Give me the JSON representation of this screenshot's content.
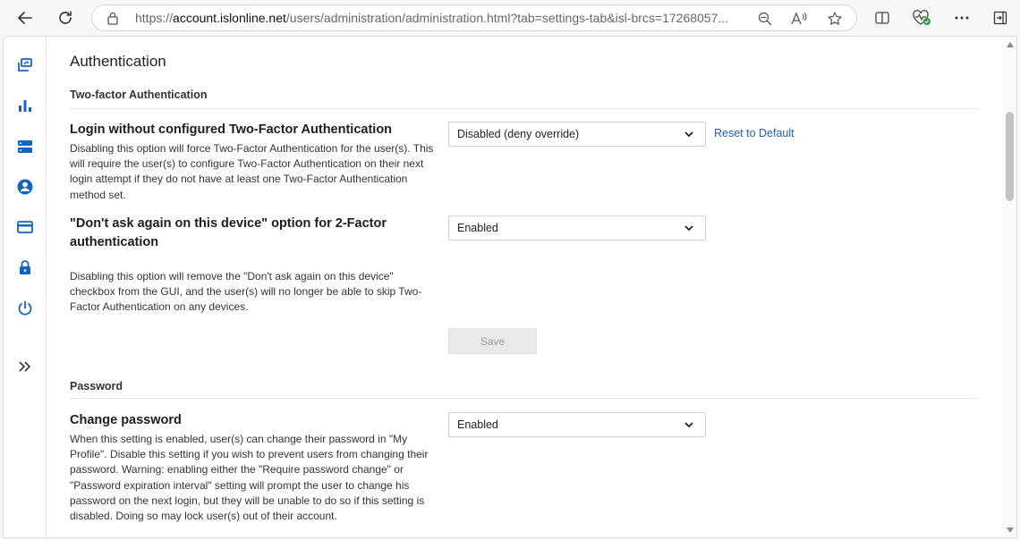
{
  "browser": {
    "url_prefix": "https://",
    "url_host": "account.islonline.net",
    "url_path": "/users/administration/administration.html?tab=settings-tab&isl-brcs=17268057..."
  },
  "sidebar": {
    "items": [
      "sessions-icon",
      "stats-icon",
      "servers-icon",
      "user-icon",
      "card-icon",
      "lock-icon",
      "power-icon"
    ],
    "expand_icon": "chevron-double-right-icon"
  },
  "page": {
    "title": "Authentication"
  },
  "two_factor": {
    "section_title": "Two-factor Authentication",
    "settings": [
      {
        "title": "Login without configured Two-Factor Authentication",
        "description": "Disabling this option will force Two-Factor Authentication for the user(s). This will require the user(s) to configure Two-Factor Authentication on their next login attempt if they do not have at least one Two-Factor Authentication method set.",
        "value": "Disabled (deny override)",
        "reset_label": "Reset to Default"
      },
      {
        "title": "\"Don't ask again on this device\" option for 2-Factor authentication",
        "description": "Disabling this option will remove the \"Don't ask again on this device\" checkbox from the GUI, and the user(s) will no longer be able to skip Two-Factor Authentication on any devices.",
        "value": "Enabled"
      }
    ],
    "save_label": "Save"
  },
  "password": {
    "section_title": "Password",
    "settings": [
      {
        "title": "Change password",
        "description": "When this setting is enabled, user(s) can change their password in \"My Profile\". Disable this setting if you wish to prevent users from changing their password. Warning: enabling either the \"Require password change\" or \"Password expiration interval\" setting will prompt the user to change his password on the next login, but they will be unable to do so if this setting is disabled. Doing so may lock user(s) out of their account.",
        "value": "Enabled"
      }
    ]
  },
  "colors": {
    "accent": "#1a5fb4",
    "sidebar_icon": "#1565c0"
  }
}
